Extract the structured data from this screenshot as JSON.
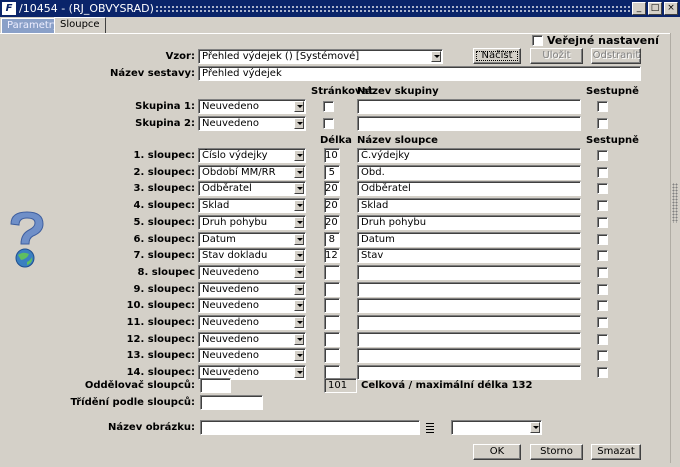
{
  "window": {
    "app_icon": "F",
    "title": "/10454 - (RJ_OBVYSRAD)",
    "buttons": [
      "_",
      "□",
      "×"
    ]
  },
  "tabs": [
    {
      "label": "Parametry"
    },
    {
      "label": "Sloupce"
    }
  ],
  "public_settings": {
    "label": "Veřejné nastavení",
    "checked": false
  },
  "vzor": {
    "label": "Vzor:",
    "value": "Přehled výdejek   ()   [Systémové]"
  },
  "buttons": {
    "load": "Načíst",
    "save": "Uložit",
    "delete": "Odstranit",
    "ok": "OK",
    "storno": "Storno",
    "smazat": "Smazat"
  },
  "report_name": {
    "label": "Název sestavy:",
    "value": "Přehled výdejek"
  },
  "group_headers": {
    "pagination": "Stránkovat",
    "group_name": "Název skupiny",
    "descending": "Sestupně"
  },
  "groups": [
    {
      "label": "Skupina 1:",
      "value": "Neuvedeno",
      "name": ""
    },
    {
      "label": "Skupina 2:",
      "value": "Neuvedeno",
      "name": ""
    }
  ],
  "column_headers": {
    "length": "Délka",
    "column_name": "Název sloupce",
    "descending": "Sestupně"
  },
  "columns": [
    {
      "label": "1. sloupec:",
      "value": "Číslo výdejky",
      "length": "10",
      "name": "Č.výdejky"
    },
    {
      "label": "2. sloupec:",
      "value": "Období MM/RR",
      "length": "5",
      "name": "Obd."
    },
    {
      "label": "3. sloupec:",
      "value": "Odběratel",
      "length": "20",
      "name": "Odběratel"
    },
    {
      "label": "4. sloupec:",
      "value": "Sklad",
      "length": "20",
      "name": "Sklad"
    },
    {
      "label": "5. sloupec:",
      "value": "Druh pohybu",
      "length": "20",
      "name": "Druh pohybu"
    },
    {
      "label": "6. sloupec:",
      "value": "Datum",
      "length": "8",
      "name": "Datum"
    },
    {
      "label": "7. sloupec:",
      "value": "Stav dokladu",
      "length": "12",
      "name": "Stav"
    },
    {
      "label": "8. sloupec",
      "value": "Neuvedeno",
      "length": "",
      "name": ""
    },
    {
      "label": "9. sloupec:",
      "value": "Neuvedeno",
      "length": "",
      "name": ""
    },
    {
      "label": "10. sloupec:",
      "value": "Neuvedeno",
      "length": "",
      "name": ""
    },
    {
      "label": "11. sloupec:",
      "value": "Neuvedeno",
      "length": "",
      "name": ""
    },
    {
      "label": "12. sloupec:",
      "value": "Neuvedeno",
      "length": "",
      "name": ""
    },
    {
      "label": "13. sloupec:",
      "value": "Neuvedeno",
      "length": "",
      "name": ""
    },
    {
      "label": "14. sloupec:",
      "value": "Neuvedeno",
      "length": "",
      "name": ""
    }
  ],
  "separator": {
    "label": "Oddělovač sloupců:",
    "value": ""
  },
  "total": {
    "value": "101",
    "text": "Celková / maximální délka 132"
  },
  "sort": {
    "label": "Třídění podle sloupců:",
    "value": ""
  },
  "image": {
    "label": "Název obrázku:",
    "value": "",
    "select_value": ""
  },
  "colors": {
    "titlebar": "#0a246a",
    "face": "#d4d0c8",
    "inactive_tab": "#8aa0c8"
  }
}
